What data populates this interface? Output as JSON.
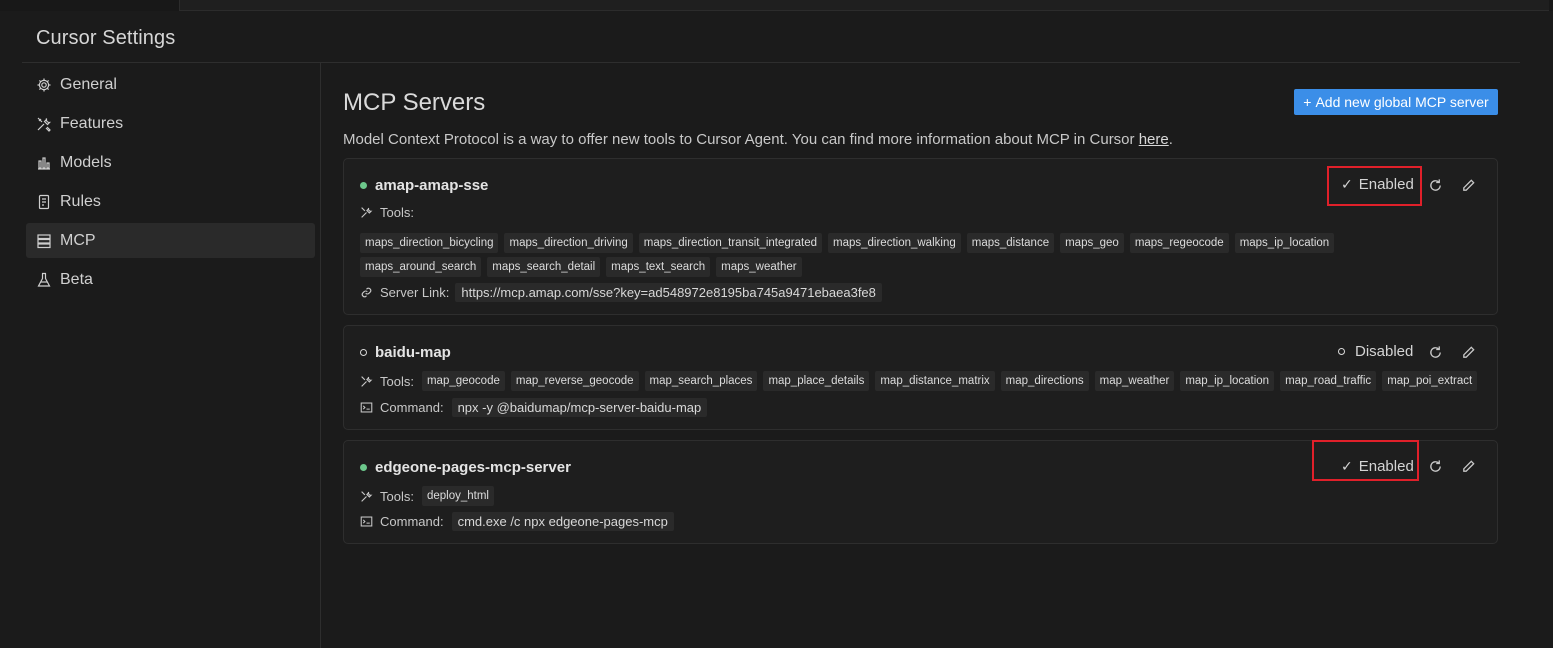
{
  "window": {
    "title": "Cursor Settings"
  },
  "sidebar": {
    "items": [
      {
        "label": "General",
        "icon": "gear-icon"
      },
      {
        "label": "Features",
        "icon": "tools-icon"
      },
      {
        "label": "Models",
        "icon": "bar-chart-icon"
      },
      {
        "label": "Rules",
        "icon": "document-icon"
      },
      {
        "label": "MCP",
        "icon": "server-icon",
        "active": true
      },
      {
        "label": "Beta",
        "icon": "flask-icon"
      }
    ]
  },
  "main": {
    "title": "MCP Servers",
    "add_button": "Add new global MCP server",
    "description": "Model Context Protocol is a way to offer new tools to Cursor Agent. You can find more information about MCP in Cursor ",
    "description_link": "here",
    "description_end": "."
  },
  "servers": [
    {
      "name": "amap-amap-sse",
      "status": "Enabled",
      "tools_label": "Tools:",
      "tools": [
        "maps_direction_bicycling",
        "maps_direction_driving",
        "maps_direction_transit_integrated",
        "maps_direction_walking",
        "maps_distance",
        "maps_geo",
        "maps_regeocode",
        "maps_ip_location",
        "maps_around_search",
        "maps_search_detail",
        "maps_text_search",
        "maps_weather"
      ],
      "link_label": "Server Link:",
      "link_value": "https://mcp.amap.com/sse?key=ad548972e8195ba745a9471ebaea3fe8"
    },
    {
      "name": "baidu-map",
      "status": "Disabled",
      "tools_label": "Tools:",
      "tools": [
        "map_geocode",
        "map_reverse_geocode",
        "map_search_places",
        "map_place_details",
        "map_distance_matrix",
        "map_directions",
        "map_weather",
        "map_ip_location",
        "map_road_traffic",
        "map_poi_extract"
      ],
      "command_label": "Command:",
      "command_value": "npx -y @baidumap/mcp-server-baidu-map"
    },
    {
      "name": "edgeone-pages-mcp-server",
      "status": "Enabled",
      "tools_label": "Tools:",
      "tools": [
        "deploy_html"
      ],
      "command_label": "Command:",
      "command_value": "cmd.exe /c npx edgeone-pages-mcp"
    }
  ],
  "colors": {
    "background": "#1b1b1b",
    "accent_button": "#3b8ee8",
    "enabled_dot": "#6cc78b",
    "highlight_box": "#e0202a"
  }
}
